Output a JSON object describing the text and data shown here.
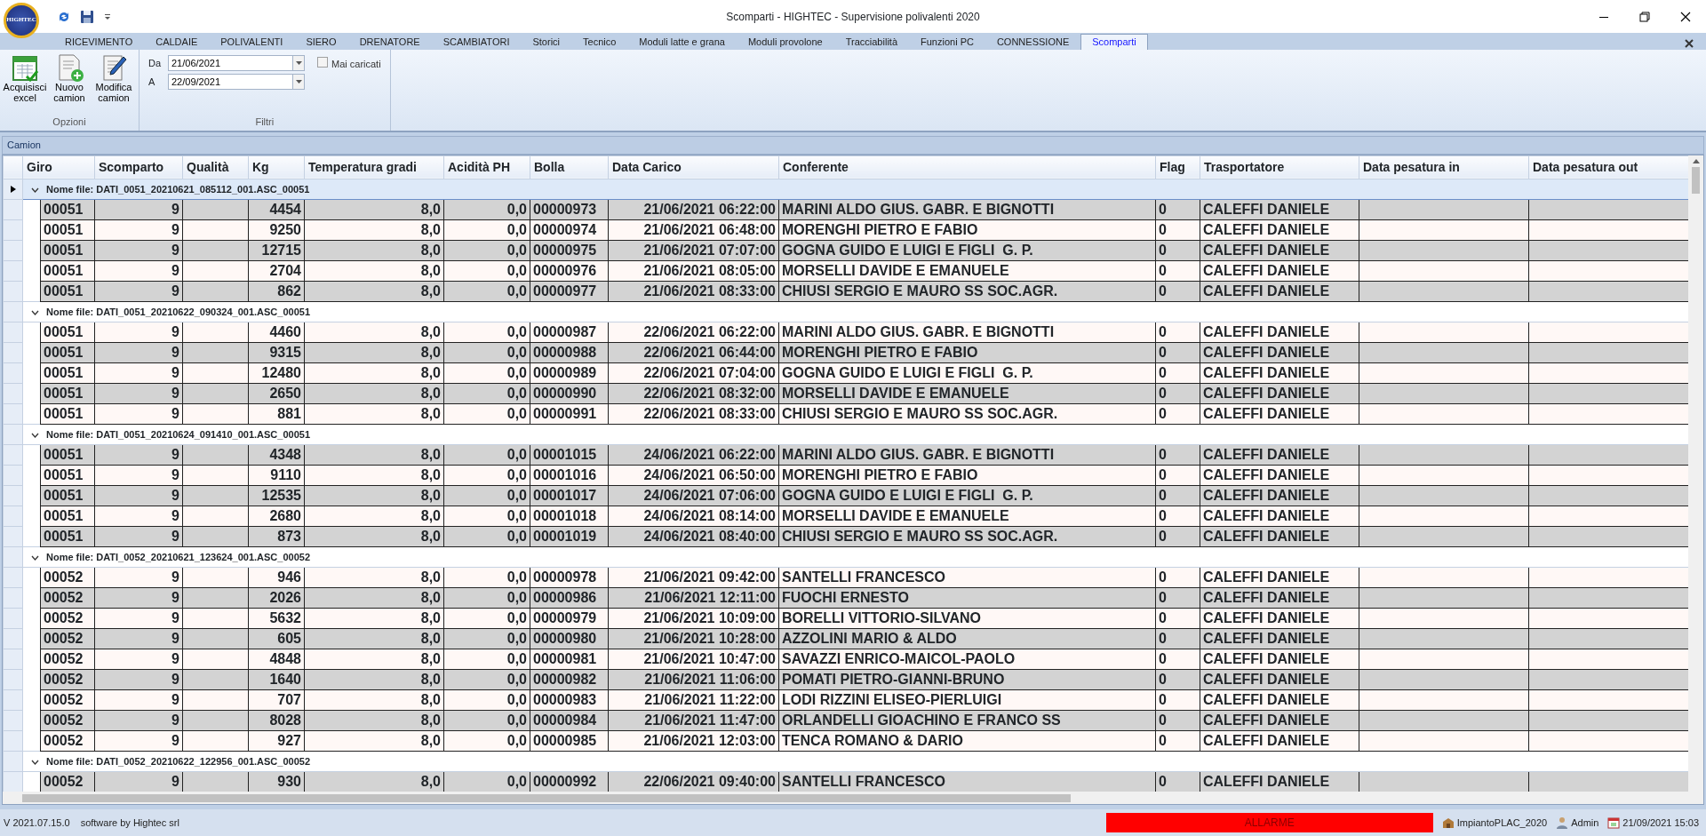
{
  "window": {
    "title": "Scomparti - HIGHTEC - Supervisione polivalenti 2020",
    "logo_text": "HIGHTEC"
  },
  "tabs": [
    {
      "label": "RICEVIMENTO",
      "selected": false
    },
    {
      "label": "CALDAIE",
      "selected": false
    },
    {
      "label": "POLIVALENTI",
      "selected": false
    },
    {
      "label": "SIERO",
      "selected": false
    },
    {
      "label": "DRENATORE",
      "selected": false
    },
    {
      "label": "SCAMBIATORI",
      "selected": false
    },
    {
      "label": "Storici",
      "selected": false
    },
    {
      "label": "Tecnico",
      "selected": false
    },
    {
      "label": "Moduli latte e grana",
      "selected": false
    },
    {
      "label": "Moduli provolone",
      "selected": false
    },
    {
      "label": "Tracciabilità",
      "selected": false
    },
    {
      "label": "Funzioni PC",
      "selected": false
    },
    {
      "label": "CONNESSIONE",
      "selected": false
    },
    {
      "label": "Scomparti",
      "selected": true
    }
  ],
  "ribbon": {
    "options": {
      "title": "Opzioni",
      "buttons": [
        {
          "kind": "excel",
          "label": "Acquisisci excel"
        },
        {
          "kind": "new",
          "label": "Nuovo camion"
        },
        {
          "kind": "edit",
          "label": "Modifica camion"
        }
      ]
    },
    "filters": {
      "title": "Filtri",
      "from_label": "Da",
      "from": "21/06/2021",
      "to_label": "A",
      "to": "22/09/2021",
      "never_loaded": {
        "label": "Mai caricati",
        "checked": false
      }
    }
  },
  "panel": {
    "title": "Camion"
  },
  "table": {
    "columns": [
      "Giro",
      "Scomparto",
      "Qualità",
      "Kg",
      "Temperatura gradi",
      "Acidità PH",
      "Bolla",
      "Data Carico",
      "Conferente",
      "Flag",
      "Trasportatore",
      "Data pesatura in",
      "Data pesatura out"
    ],
    "groups": [
      {
        "label": "Nome file: DATI_0051_20210621_085112_001.ASC_00051",
        "expanded": true,
        "selected": true,
        "rows": [
          {
            "giro": "00051",
            "scomparto": "9",
            "kg": "4454",
            "temperatura": "8,0",
            "acidita": "0,0",
            "bolla": "00000973",
            "data_carico": "21/06/2021 06:22:00",
            "conferente": "MARINI ALDO GIUS. GABR. E BIGNOTTI",
            "flag": "0",
            "trasportatore": "CALEFFI DANIELE"
          },
          {
            "giro": "00051",
            "scomparto": "9",
            "kg": "9250",
            "temperatura": "8,0",
            "acidita": "0,0",
            "bolla": "00000974",
            "data_carico": "21/06/2021 06:48:00",
            "conferente": "MORENGHI PIETRO E FABIO",
            "flag": "0",
            "trasportatore": "CALEFFI DANIELE"
          },
          {
            "giro": "00051",
            "scomparto": "9",
            "kg": "12715",
            "temperatura": "8,0",
            "acidita": "0,0",
            "bolla": "00000975",
            "data_carico": "21/06/2021 07:07:00",
            "conferente": "GOGNA GUIDO E LUIGI E FIGLI  G. P.",
            "flag": "0",
            "trasportatore": "CALEFFI DANIELE"
          },
          {
            "giro": "00051",
            "scomparto": "9",
            "kg": "2704",
            "temperatura": "8,0",
            "acidita": "0,0",
            "bolla": "00000976",
            "data_carico": "21/06/2021 08:05:00",
            "conferente": "MORSELLI DAVIDE E EMANUELE",
            "flag": "0",
            "trasportatore": "CALEFFI DANIELE"
          },
          {
            "giro": "00051",
            "scomparto": "9",
            "kg": "862",
            "temperatura": "8,0",
            "acidita": "0,0",
            "bolla": "00000977",
            "data_carico": "21/06/2021 08:33:00",
            "conferente": "CHIUSI SERGIO E MAURO SS SOC.AGR.",
            "flag": "0",
            "trasportatore": "CALEFFI DANIELE"
          }
        ]
      },
      {
        "label": "Nome file: DATI_0051_20210622_090324_001.ASC_00051",
        "expanded": true,
        "selected": false,
        "rows": [
          {
            "giro": "00051",
            "scomparto": "9",
            "kg": "4460",
            "temperatura": "8,0",
            "acidita": "0,0",
            "bolla": "00000987",
            "data_carico": "22/06/2021 06:22:00",
            "conferente": "MARINI ALDO GIUS. GABR. E BIGNOTTI",
            "flag": "0",
            "trasportatore": "CALEFFI DANIELE"
          },
          {
            "giro": "00051",
            "scomparto": "9",
            "kg": "9315",
            "temperatura": "8,0",
            "acidita": "0,0",
            "bolla": "00000988",
            "data_carico": "22/06/2021 06:44:00",
            "conferente": "MORENGHI PIETRO E FABIO",
            "flag": "0",
            "trasportatore": "CALEFFI DANIELE"
          },
          {
            "giro": "00051",
            "scomparto": "9",
            "kg": "12480",
            "temperatura": "8,0",
            "acidita": "0,0",
            "bolla": "00000989",
            "data_carico": "22/06/2021 07:04:00",
            "conferente": "GOGNA GUIDO E LUIGI E FIGLI  G. P.",
            "flag": "0",
            "trasportatore": "CALEFFI DANIELE"
          },
          {
            "giro": "00051",
            "scomparto": "9",
            "kg": "2650",
            "temperatura": "8,0",
            "acidita": "0,0",
            "bolla": "00000990",
            "data_carico": "22/06/2021 08:32:00",
            "conferente": "MORSELLI DAVIDE E EMANUELE",
            "flag": "0",
            "trasportatore": "CALEFFI DANIELE"
          },
          {
            "giro": "00051",
            "scomparto": "9",
            "kg": "881",
            "temperatura": "8,0",
            "acidita": "0,0",
            "bolla": "00000991",
            "data_carico": "22/06/2021 08:33:00",
            "conferente": "CHIUSI SERGIO E MAURO SS SOC.AGR.",
            "flag": "0",
            "trasportatore": "CALEFFI DANIELE"
          }
        ]
      },
      {
        "label": "Nome file: DATI_0051_20210624_091410_001.ASC_00051",
        "expanded": true,
        "selected": false,
        "rows": [
          {
            "giro": "00051",
            "scomparto": "9",
            "kg": "4348",
            "temperatura": "8,0",
            "acidita": "0,0",
            "bolla": "00001015",
            "data_carico": "24/06/2021 06:22:00",
            "conferente": "MARINI ALDO GIUS. GABR. E BIGNOTTI",
            "flag": "0",
            "trasportatore": "CALEFFI DANIELE"
          },
          {
            "giro": "00051",
            "scomparto": "9",
            "kg": "9110",
            "temperatura": "8,0",
            "acidita": "0,0",
            "bolla": "00001016",
            "data_carico": "24/06/2021 06:50:00",
            "conferente": "MORENGHI PIETRO E FABIO",
            "flag": "0",
            "trasportatore": "CALEFFI DANIELE"
          },
          {
            "giro": "00051",
            "scomparto": "9",
            "kg": "12535",
            "temperatura": "8,0",
            "acidita": "0,0",
            "bolla": "00001017",
            "data_carico": "24/06/2021 07:06:00",
            "conferente": "GOGNA GUIDO E LUIGI E FIGLI  G. P.",
            "flag": "0",
            "trasportatore": "CALEFFI DANIELE"
          },
          {
            "giro": "00051",
            "scomparto": "9",
            "kg": "2680",
            "temperatura": "8,0",
            "acidita": "0,0",
            "bolla": "00001018",
            "data_carico": "24/06/2021 08:14:00",
            "conferente": "MORSELLI DAVIDE E EMANUELE",
            "flag": "0",
            "trasportatore": "CALEFFI DANIELE"
          },
          {
            "giro": "00051",
            "scomparto": "9",
            "kg": "873",
            "temperatura": "8,0",
            "acidita": "0,0",
            "bolla": "00001019",
            "data_carico": "24/06/2021 08:40:00",
            "conferente": "CHIUSI SERGIO E MAURO SS SOC.AGR.",
            "flag": "0",
            "trasportatore": "CALEFFI DANIELE"
          }
        ]
      },
      {
        "label": "Nome file: DATI_0052_20210621_123624_001.ASC_00052",
        "expanded": true,
        "selected": false,
        "rows": [
          {
            "giro": "00052",
            "scomparto": "9",
            "kg": "946",
            "temperatura": "8,0",
            "acidita": "0,0",
            "bolla": "00000978",
            "data_carico": "21/06/2021 09:42:00",
            "conferente": "SANTELLI FRANCESCO",
            "flag": "0",
            "trasportatore": "CALEFFI DANIELE"
          },
          {
            "giro": "00052",
            "scomparto": "9",
            "kg": "2026",
            "temperatura": "8,0",
            "acidita": "0,0",
            "bolla": "00000986",
            "data_carico": "21/06/2021 12:11:00",
            "conferente": "FUOCHI ERNESTO",
            "flag": "0",
            "trasportatore": "CALEFFI DANIELE"
          },
          {
            "giro": "00052",
            "scomparto": "9",
            "kg": "5632",
            "temperatura": "8,0",
            "acidita": "0,0",
            "bolla": "00000979",
            "data_carico": "21/06/2021 10:09:00",
            "conferente": "BORELLI VITTORIO-SILVANO",
            "flag": "0",
            "trasportatore": "CALEFFI DANIELE"
          },
          {
            "giro": "00052",
            "scomparto": "9",
            "kg": "605",
            "temperatura": "8,0",
            "acidita": "0,0",
            "bolla": "00000980",
            "data_carico": "21/06/2021 10:28:00",
            "conferente": "AZZOLINI MARIO & ALDO",
            "flag": "0",
            "trasportatore": "CALEFFI DANIELE"
          },
          {
            "giro": "00052",
            "scomparto": "9",
            "kg": "4848",
            "temperatura": "8,0",
            "acidita": "0,0",
            "bolla": "00000981",
            "data_carico": "21/06/2021 10:47:00",
            "conferente": "SAVAZZI ENRICO-MAICOL-PAOLO",
            "flag": "0",
            "trasportatore": "CALEFFI DANIELE"
          },
          {
            "giro": "00052",
            "scomparto": "9",
            "kg": "1640",
            "temperatura": "8,0",
            "acidita": "0,0",
            "bolla": "00000982",
            "data_carico": "21/06/2021 11:06:00",
            "conferente": "POMATI PIETRO-GIANNI-BRUNO",
            "flag": "0",
            "trasportatore": "CALEFFI DANIELE"
          },
          {
            "giro": "00052",
            "scomparto": "9",
            "kg": "707",
            "temperatura": "8,0",
            "acidita": "0,0",
            "bolla": "00000983",
            "data_carico": "21/06/2021 11:22:00",
            "conferente": "LODI RIZZINI ELISEO-PIERLUIGI",
            "flag": "0",
            "trasportatore": "CALEFFI DANIELE"
          },
          {
            "giro": "00052",
            "scomparto": "9",
            "kg": "8028",
            "temperatura": "8,0",
            "acidita": "0,0",
            "bolla": "00000984",
            "data_carico": "21/06/2021 11:47:00",
            "conferente": "ORLANDELLI GIOACHINO E FRANCO SS",
            "flag": "0",
            "trasportatore": "CALEFFI DANIELE"
          },
          {
            "giro": "00052",
            "scomparto": "9",
            "kg": "927",
            "temperatura": "8,0",
            "acidita": "0,0",
            "bolla": "00000985",
            "data_carico": "21/06/2021 12:03:00",
            "conferente": "TENCA ROMANO & DARIO",
            "flag": "0",
            "trasportatore": "CALEFFI DANIELE"
          }
        ]
      },
      {
        "label": "Nome file: DATI_0052_20210622_122956_001.ASC_00052",
        "expanded": true,
        "selected": false,
        "rows": [
          {
            "giro": "00052",
            "scomparto": "9",
            "kg": "930",
            "temperatura": "8,0",
            "acidita": "0,0",
            "bolla": "00000992",
            "data_carico": "22/06/2021 09:40:00",
            "conferente": "SANTELLI FRANCESCO",
            "flag": "0",
            "trasportatore": "CALEFFI DANIELE"
          }
        ]
      }
    ]
  },
  "status_bar": {
    "version": "V 2021.07.15.0",
    "credit": "software by Hightec srl",
    "alarm": "ALLARME",
    "plant": "ImpiantoPLAC_2020",
    "user": "Admin",
    "datetime": "21/09/2021 15:03"
  }
}
